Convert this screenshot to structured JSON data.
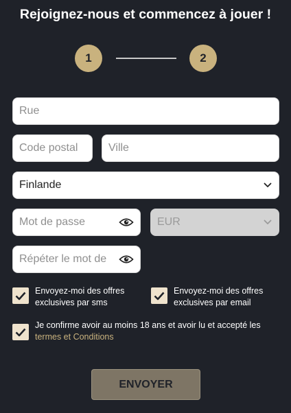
{
  "header": {
    "title": "Rejoignez-nous et commencez à jouer !"
  },
  "steps": {
    "step1": "1",
    "step2": "2",
    "active_color": "#c9b27e"
  },
  "form": {
    "street": {
      "placeholder": "Rue",
      "value": ""
    },
    "postal": {
      "placeholder": "Code postal",
      "value": ""
    },
    "city": {
      "placeholder": "Ville",
      "value": ""
    },
    "country": {
      "value": "Finlande"
    },
    "password": {
      "placeholder": "Mot de passe",
      "value": ""
    },
    "currency": {
      "value": "EUR",
      "disabled": true
    },
    "repeat_password": {
      "placeholder": "Répéter le mot de",
      "value": ""
    }
  },
  "consents": {
    "sms": {
      "label": "Envoyez-moi des offres exclusives par sms",
      "checked": true
    },
    "email": {
      "label": "Envoyez-moi des offres exclusives par email",
      "checked": true
    },
    "terms": {
      "label": "Je confirme avoir au moins 18 ans et avoir lu et accepté les",
      "link": "termes et Conditions",
      "checked": true
    }
  },
  "submit": {
    "label": "ENVOYER"
  },
  "colors": {
    "background": "#1f2229",
    "accent": "#c9b27e",
    "checkbox": "#efe3cd",
    "button": "#7e7565"
  }
}
